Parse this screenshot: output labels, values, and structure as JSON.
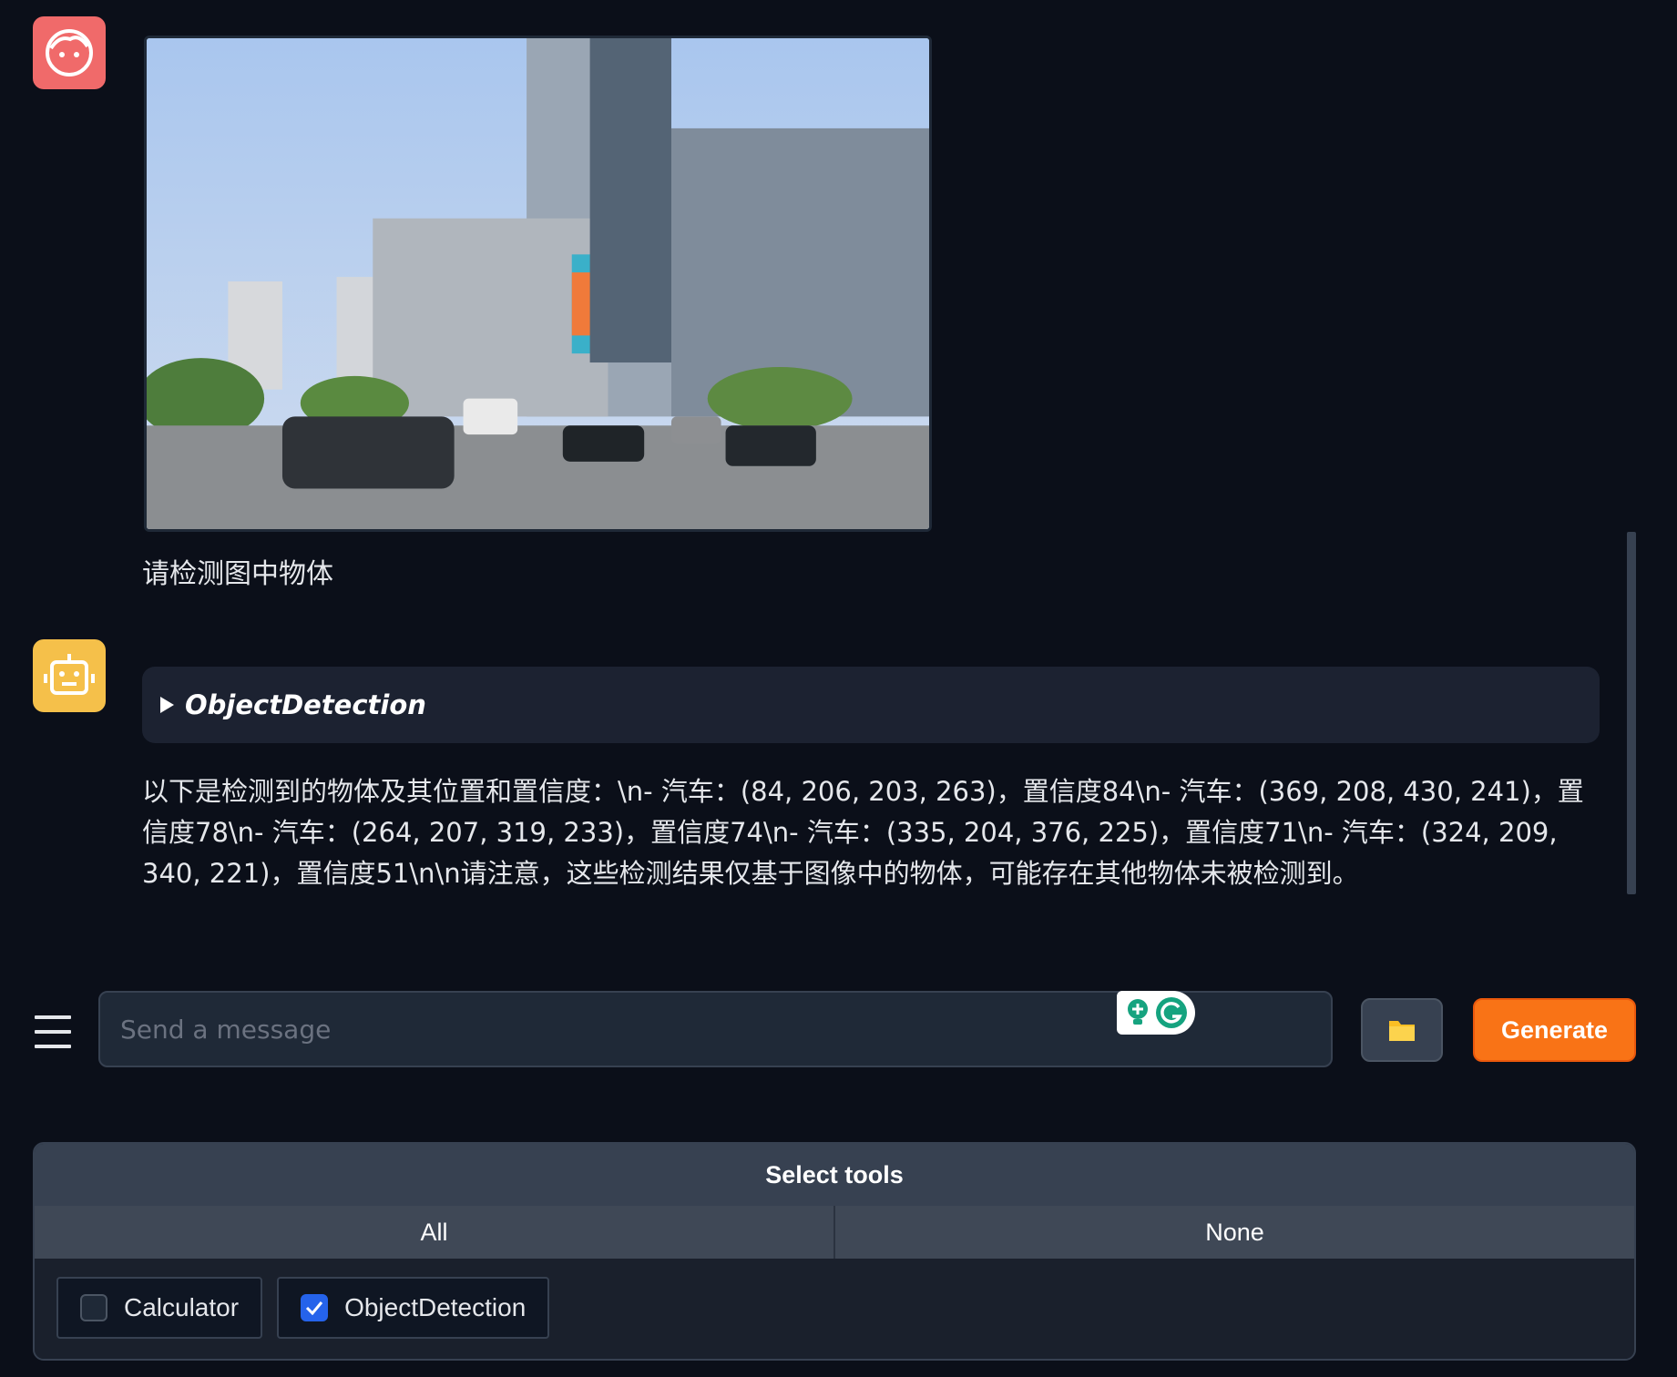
{
  "chat": {
    "user_message": "请检测图中物体",
    "tool_call": "ObjectDetection",
    "bot_message": "以下是检测到的物体及其位置和置信度：\\n- 汽车：(84, 206, 203, 263)，置信度84\\n- 汽车：(369, 208, 430, 241)，置信度78\\n- 汽车：(264, 207, 319, 233)，置信度74\\n- 汽车：(335, 204, 376, 225)，置信度71\\n- 汽车：(324, 209, 340, 221)，置信度51\\n\\n请注意，这些检测结果仅基于图像中的物体，可能存在其他物体未被检测到。"
  },
  "input": {
    "placeholder": "Send a message",
    "generate_label": "Generate"
  },
  "tools": {
    "title": "Select tools",
    "all_label": "All",
    "none_label": "None",
    "items": [
      {
        "label": "Calculator",
        "checked": false
      },
      {
        "label": "ObjectDetection",
        "checked": true
      }
    ]
  },
  "colors": {
    "background": "#0b0f19",
    "user_avatar": "#f06a6a",
    "bot_avatar": "#f5c04a",
    "generate_button": "#f97316",
    "checkbox_checked": "#2563eb"
  }
}
